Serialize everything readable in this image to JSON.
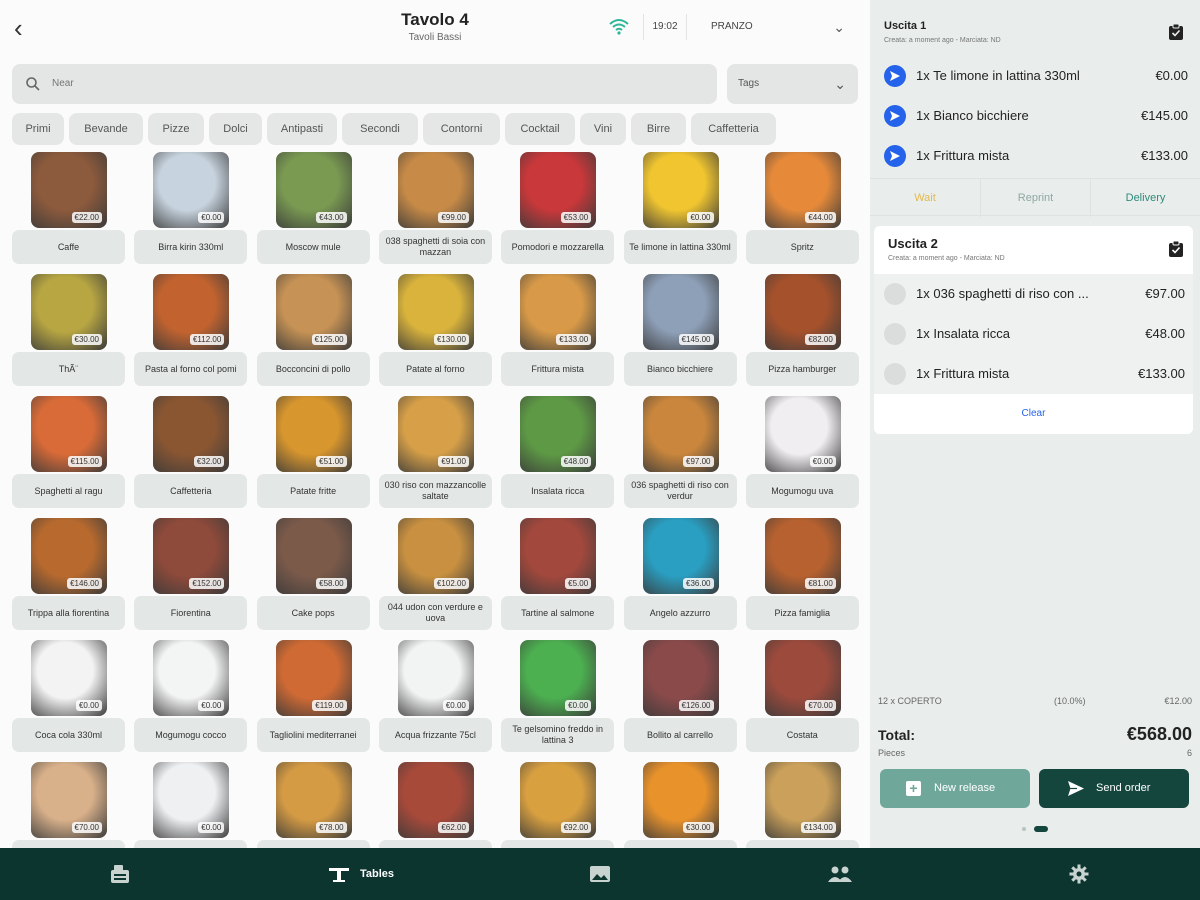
{
  "header": {
    "title": "Tavolo 4",
    "subtitle": "Tavoli Bassi",
    "time": "19:02",
    "shift": "PRANZO"
  },
  "search": {
    "placeholder": "Near"
  },
  "tags": {
    "label": "Tags"
  },
  "categories": [
    "Primi",
    "Bevande",
    "Pizze",
    "Dolci",
    "Antipasti",
    "Secondi",
    "Contorni",
    "Cocktail",
    "Vini",
    "Birre",
    "Caffetteria"
  ],
  "products": [
    {
      "name": "Caffe",
      "price": "€22.00",
      "color": "#8c5a3c"
    },
    {
      "name": "Birra kirin 330ml",
      "price": "€0.00",
      "color": "#c7d3de"
    },
    {
      "name": "Moscow mule",
      "price": "€43.00",
      "color": "#7a9a52"
    },
    {
      "name": "038 spaghetti di soia con mazzan",
      "price": "€99.00",
      "color": "#c88b47"
    },
    {
      "name": "Pomodori e mozzarella",
      "price": "€53.00",
      "color": "#c9383a"
    },
    {
      "name": "Te limone in lattina 330ml",
      "price": "€0.00",
      "color": "#f0c530"
    },
    {
      "name": "Spritz",
      "price": "€44.00",
      "color": "#e68a3a"
    },
    {
      "name": "ThÃ¨",
      "price": "€30.00",
      "color": "#b7a642"
    },
    {
      "name": "Pasta al forno col pomi",
      "price": "€112.00",
      "color": "#c2632f"
    },
    {
      "name": "Bocconcini di pollo",
      "price": "€125.00",
      "color": "#c69255"
    },
    {
      "name": "Patate al forno",
      "price": "€130.00",
      "color": "#d9b33c"
    },
    {
      "name": "Frittura mista",
      "price": "€133.00",
      "color": "#d89a48"
    },
    {
      "name": "Bianco bicchiere",
      "price": "€145.00",
      "color": "#8ea0b8"
    },
    {
      "name": "Pizza hamburger",
      "price": "€82.00",
      "color": "#a4512c"
    },
    {
      "name": "Spaghetti al ragu",
      "price": "€115.00",
      "color": "#d96b38"
    },
    {
      "name": "Caffetteria",
      "price": "€32.00",
      "color": "#8a5632"
    },
    {
      "name": "Patate fritte",
      "price": "€51.00",
      "color": "#d8962e"
    },
    {
      "name": "030 riso con mazzancolle saltate",
      "price": "€91.00",
      "color": "#d7a048"
    },
    {
      "name": "Insalata ricca",
      "price": "€48.00",
      "color": "#5e9a45"
    },
    {
      "name": "036 spaghetti di riso con verdur",
      "price": "€97.00",
      "color": "#c9863c"
    },
    {
      "name": "Mogumogu uva",
      "price": "€0.00",
      "color": "#f1eef2"
    },
    {
      "name": "Trippa alla fiorentina",
      "price": "€146.00",
      "color": "#b86a2e"
    },
    {
      "name": "Fiorentina",
      "price": "€152.00",
      "color": "#8e4a3a"
    },
    {
      "name": "Cake pops",
      "price": "€58.00",
      "color": "#7b5a4a"
    },
    {
      "name": "044 udon con verdure e uova",
      "price": "€102.00",
      "color": "#c89040"
    },
    {
      "name": "Tartine al salmone",
      "price": "€5.00",
      "color": "#a3483c"
    },
    {
      "name": "Angelo azzurro",
      "price": "€36.00",
      "color": "#2a9fc2"
    },
    {
      "name": "Pizza famiglia",
      "price": "€81.00",
      "color": "#b6612f"
    },
    {
      "name": "Coca cola 330ml",
      "price": "€0.00",
      "color": "#f3f3f3"
    },
    {
      "name": "Mogumogu cocco",
      "price": "€0.00",
      "color": "#f3f5f4"
    },
    {
      "name": "Tagliolini mediterranei",
      "price": "€119.00",
      "color": "#cf6a34"
    },
    {
      "name": "Acqua frizzante 75cl",
      "price": "€0.00",
      "color": "#f1f4f2"
    },
    {
      "name": "Te gelsomino freddo in lattina 3",
      "price": "€0.00",
      "color": "#4caf50"
    },
    {
      "name": "Bollito al carrello",
      "price": "€126.00",
      "color": "#8a4a4a"
    },
    {
      "name": "Costata",
      "price": "€70.00",
      "color": "#9b4a3c"
    },
    {
      "name": "",
      "price": "€70.00",
      "color": "#d8b08a"
    },
    {
      "name": "",
      "price": "€0.00",
      "color": "#eef0f2"
    },
    {
      "name": "",
      "price": "€78.00",
      "color": "#d49a44"
    },
    {
      "name": "",
      "price": "€62.00",
      "color": "#a84a3a"
    },
    {
      "name": "",
      "price": "€92.00",
      "color": "#d9a040"
    },
    {
      "name": "",
      "price": "€30.00",
      "color": "#e8922c"
    },
    {
      "name": "",
      "price": "€134.00",
      "color": "#caa05a"
    }
  ],
  "order1": {
    "title": "Uscita 1",
    "sub": "Creata: a moment ago - Marciata: ND",
    "items": [
      {
        "q": "1x Te limone in lattina 330ml",
        "p": "€0.00"
      },
      {
        "q": "1x Bianco bicchiere",
        "p": "€145.00"
      },
      {
        "q": "1x Frittura mista",
        "p": "€133.00"
      }
    ],
    "actions": [
      "Wait",
      "Reprint",
      "Delivery"
    ]
  },
  "order2": {
    "title": "Uscita 2",
    "sub": "Creata: a moment ago - Marciata: ND",
    "items": [
      {
        "q": "1x 036 spaghetti di riso con ...",
        "p": "€97.00"
      },
      {
        "q": "1x Insalata ricca",
        "p": "€48.00"
      },
      {
        "q": "1x Frittura mista",
        "p": "€133.00"
      }
    ],
    "clear": "Clear"
  },
  "summary": {
    "coperto": "12 x COPERTO",
    "pct": "(10.0%)",
    "cop_val": "€12.00",
    "total_label": "Total:",
    "total": "€568.00",
    "pieces_label": "Pieces",
    "pieces": "6"
  },
  "buttons": {
    "new_release": "New release",
    "send": "Send order"
  },
  "nav": {
    "tables": "Tables"
  },
  "colors": {
    "accent": "#14463e",
    "blue": "#2563eb",
    "wait": "#e8b84a",
    "teal": "#2f8a7a"
  }
}
